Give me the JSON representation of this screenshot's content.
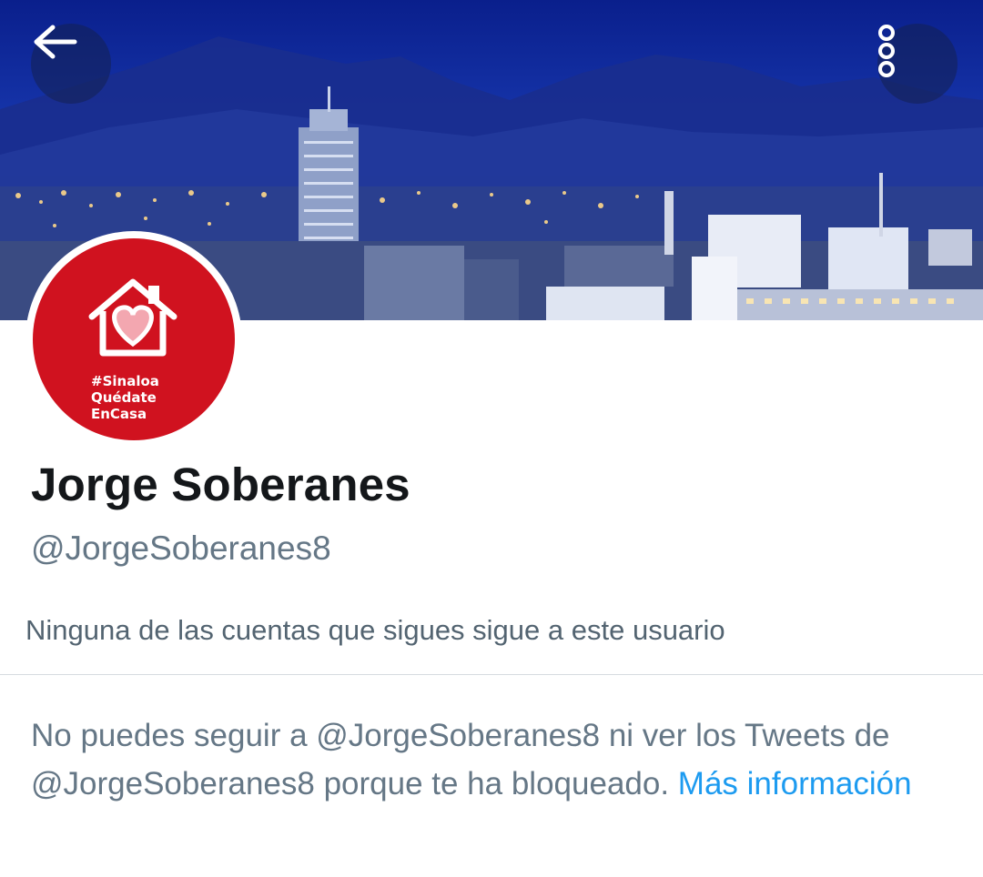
{
  "header": {
    "back_icon": "arrow-left-icon",
    "more_icon": "more-vertical-icon",
    "banner_description": ""
  },
  "profile": {
    "avatar": {
      "lines": [
        "#Sinaloa",
        "Quédate",
        "EnCasa"
      ],
      "background_color": "#d0121f"
    },
    "display_name": "Jorge Soberanes",
    "handle": "@JorgeSoberanes8",
    "followers_you_know": "Ninguna de las cuentas que sigues sigue a este usuario"
  },
  "blocked_notice": {
    "text": "No puedes seguir a @JorgeSoberanes8 ni ver los Tweets de @JorgeSoberanes8 porque te ha bloqueado.",
    "link_label": "Más información",
    "link_color": "#1d9bf0"
  },
  "colors": {
    "name": "#14171a",
    "secondary_text": "#657786",
    "divider": "#d6dbe0"
  }
}
